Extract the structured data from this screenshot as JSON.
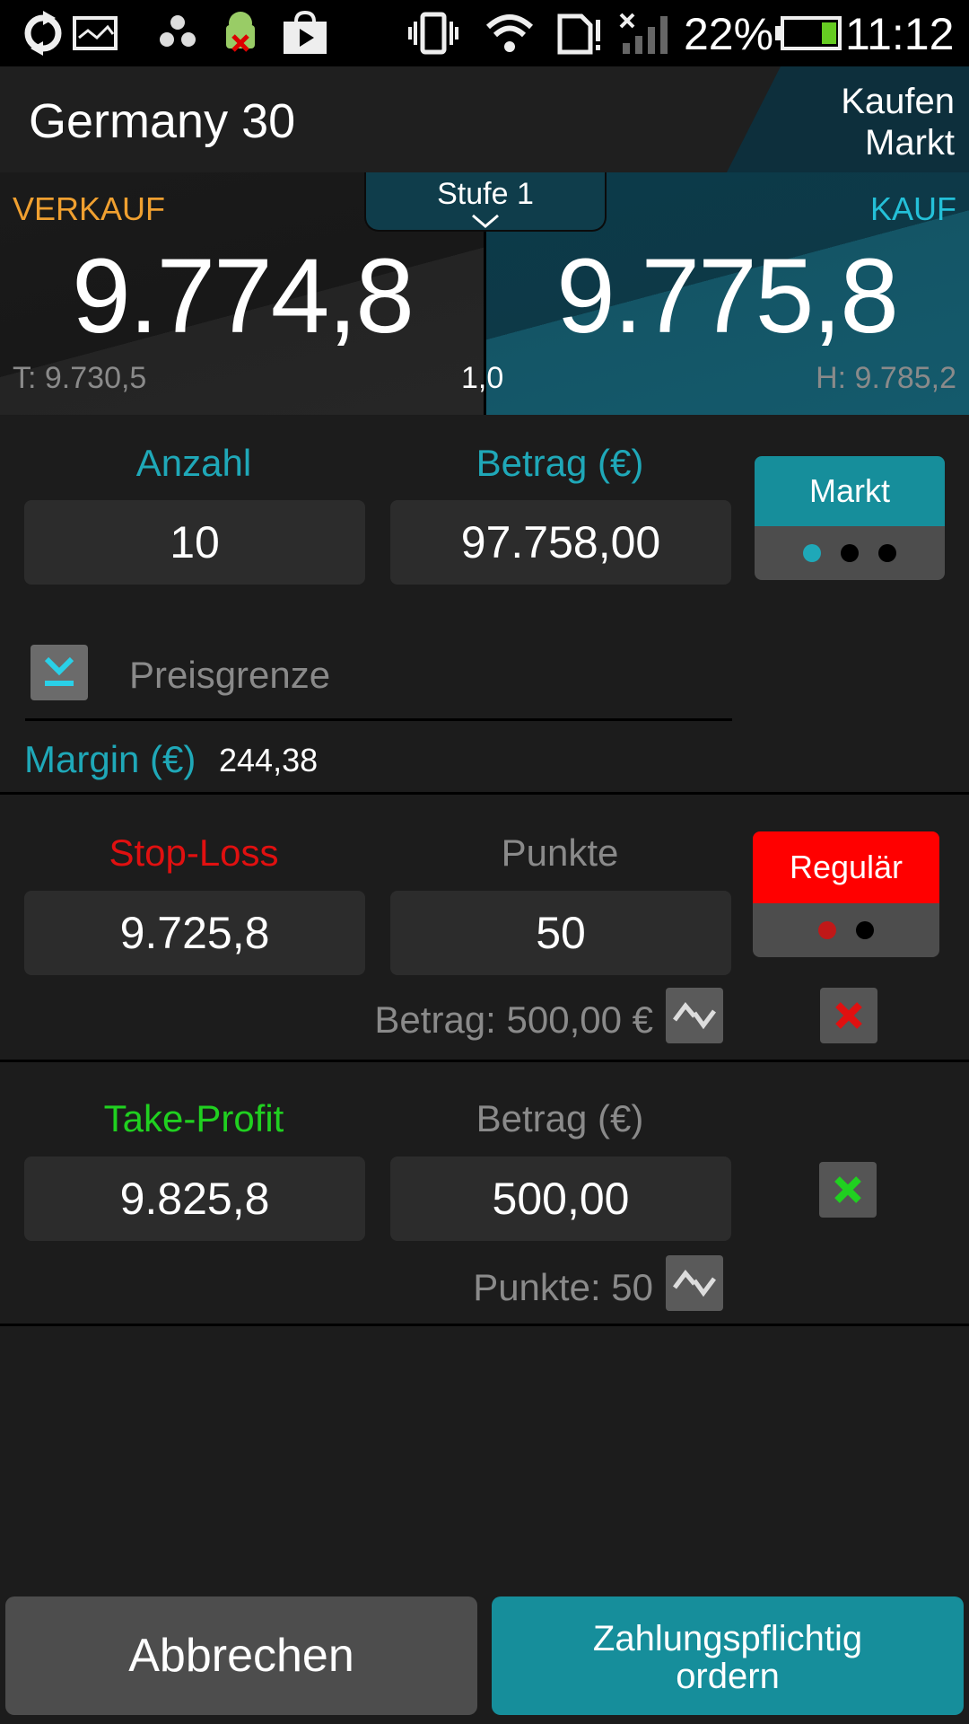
{
  "status_bar": {
    "icons": [
      "sync-icon",
      "image-icon",
      "fan-icon",
      "android-debug-icon",
      "play-store-icon",
      "vibrate-icon",
      "wifi-icon",
      "sd-card-icon",
      "signal-icon",
      "battery-icon"
    ],
    "battery": "22%",
    "time": "11:12"
  },
  "header": {
    "title": "Germany 30",
    "mode_line1": "Kaufen",
    "mode_line2": "Markt"
  },
  "prices": {
    "level_selector": "Stufe 1",
    "sell_label": "VERKAUF",
    "sell_price": "9.774,8",
    "low": "T: 9.730,5",
    "spread": "1,0",
    "buy_label": "KAUF",
    "buy_price": "9.775,8",
    "high": "H: 9.785,2"
  },
  "order": {
    "quantity_label": "Anzahl",
    "quantity_value": "10",
    "amount_label": "Betrag (€)",
    "amount_value": "97.758,00",
    "order_type": "Markt",
    "limit_placeholder": "Preisgrenze",
    "margin_label": "Margin (€)",
    "margin_value": "244,38"
  },
  "stop_loss": {
    "label": "Stop-Loss",
    "value": "9.725,8",
    "points_label": "Punkte",
    "points_value": "50",
    "type": "Regulär",
    "amount_text": "Betrag: 500,00 €"
  },
  "take_profit": {
    "label": "Take-Profit",
    "value": "9.825,8",
    "amount_label": "Betrag (€)",
    "amount_value": "500,00",
    "points_text": "Punkte: 50"
  },
  "actions": {
    "cancel": "Abbrechen",
    "submit_line1": "Zahlungspflichtig",
    "submit_line2": "ordern"
  },
  "colors": {
    "accent_teal": "#168e9b",
    "sell_orange": "#f0a030",
    "buy_cyan": "#24c0d8",
    "stop_red": "#e01010",
    "profit_green": "#20d020"
  }
}
